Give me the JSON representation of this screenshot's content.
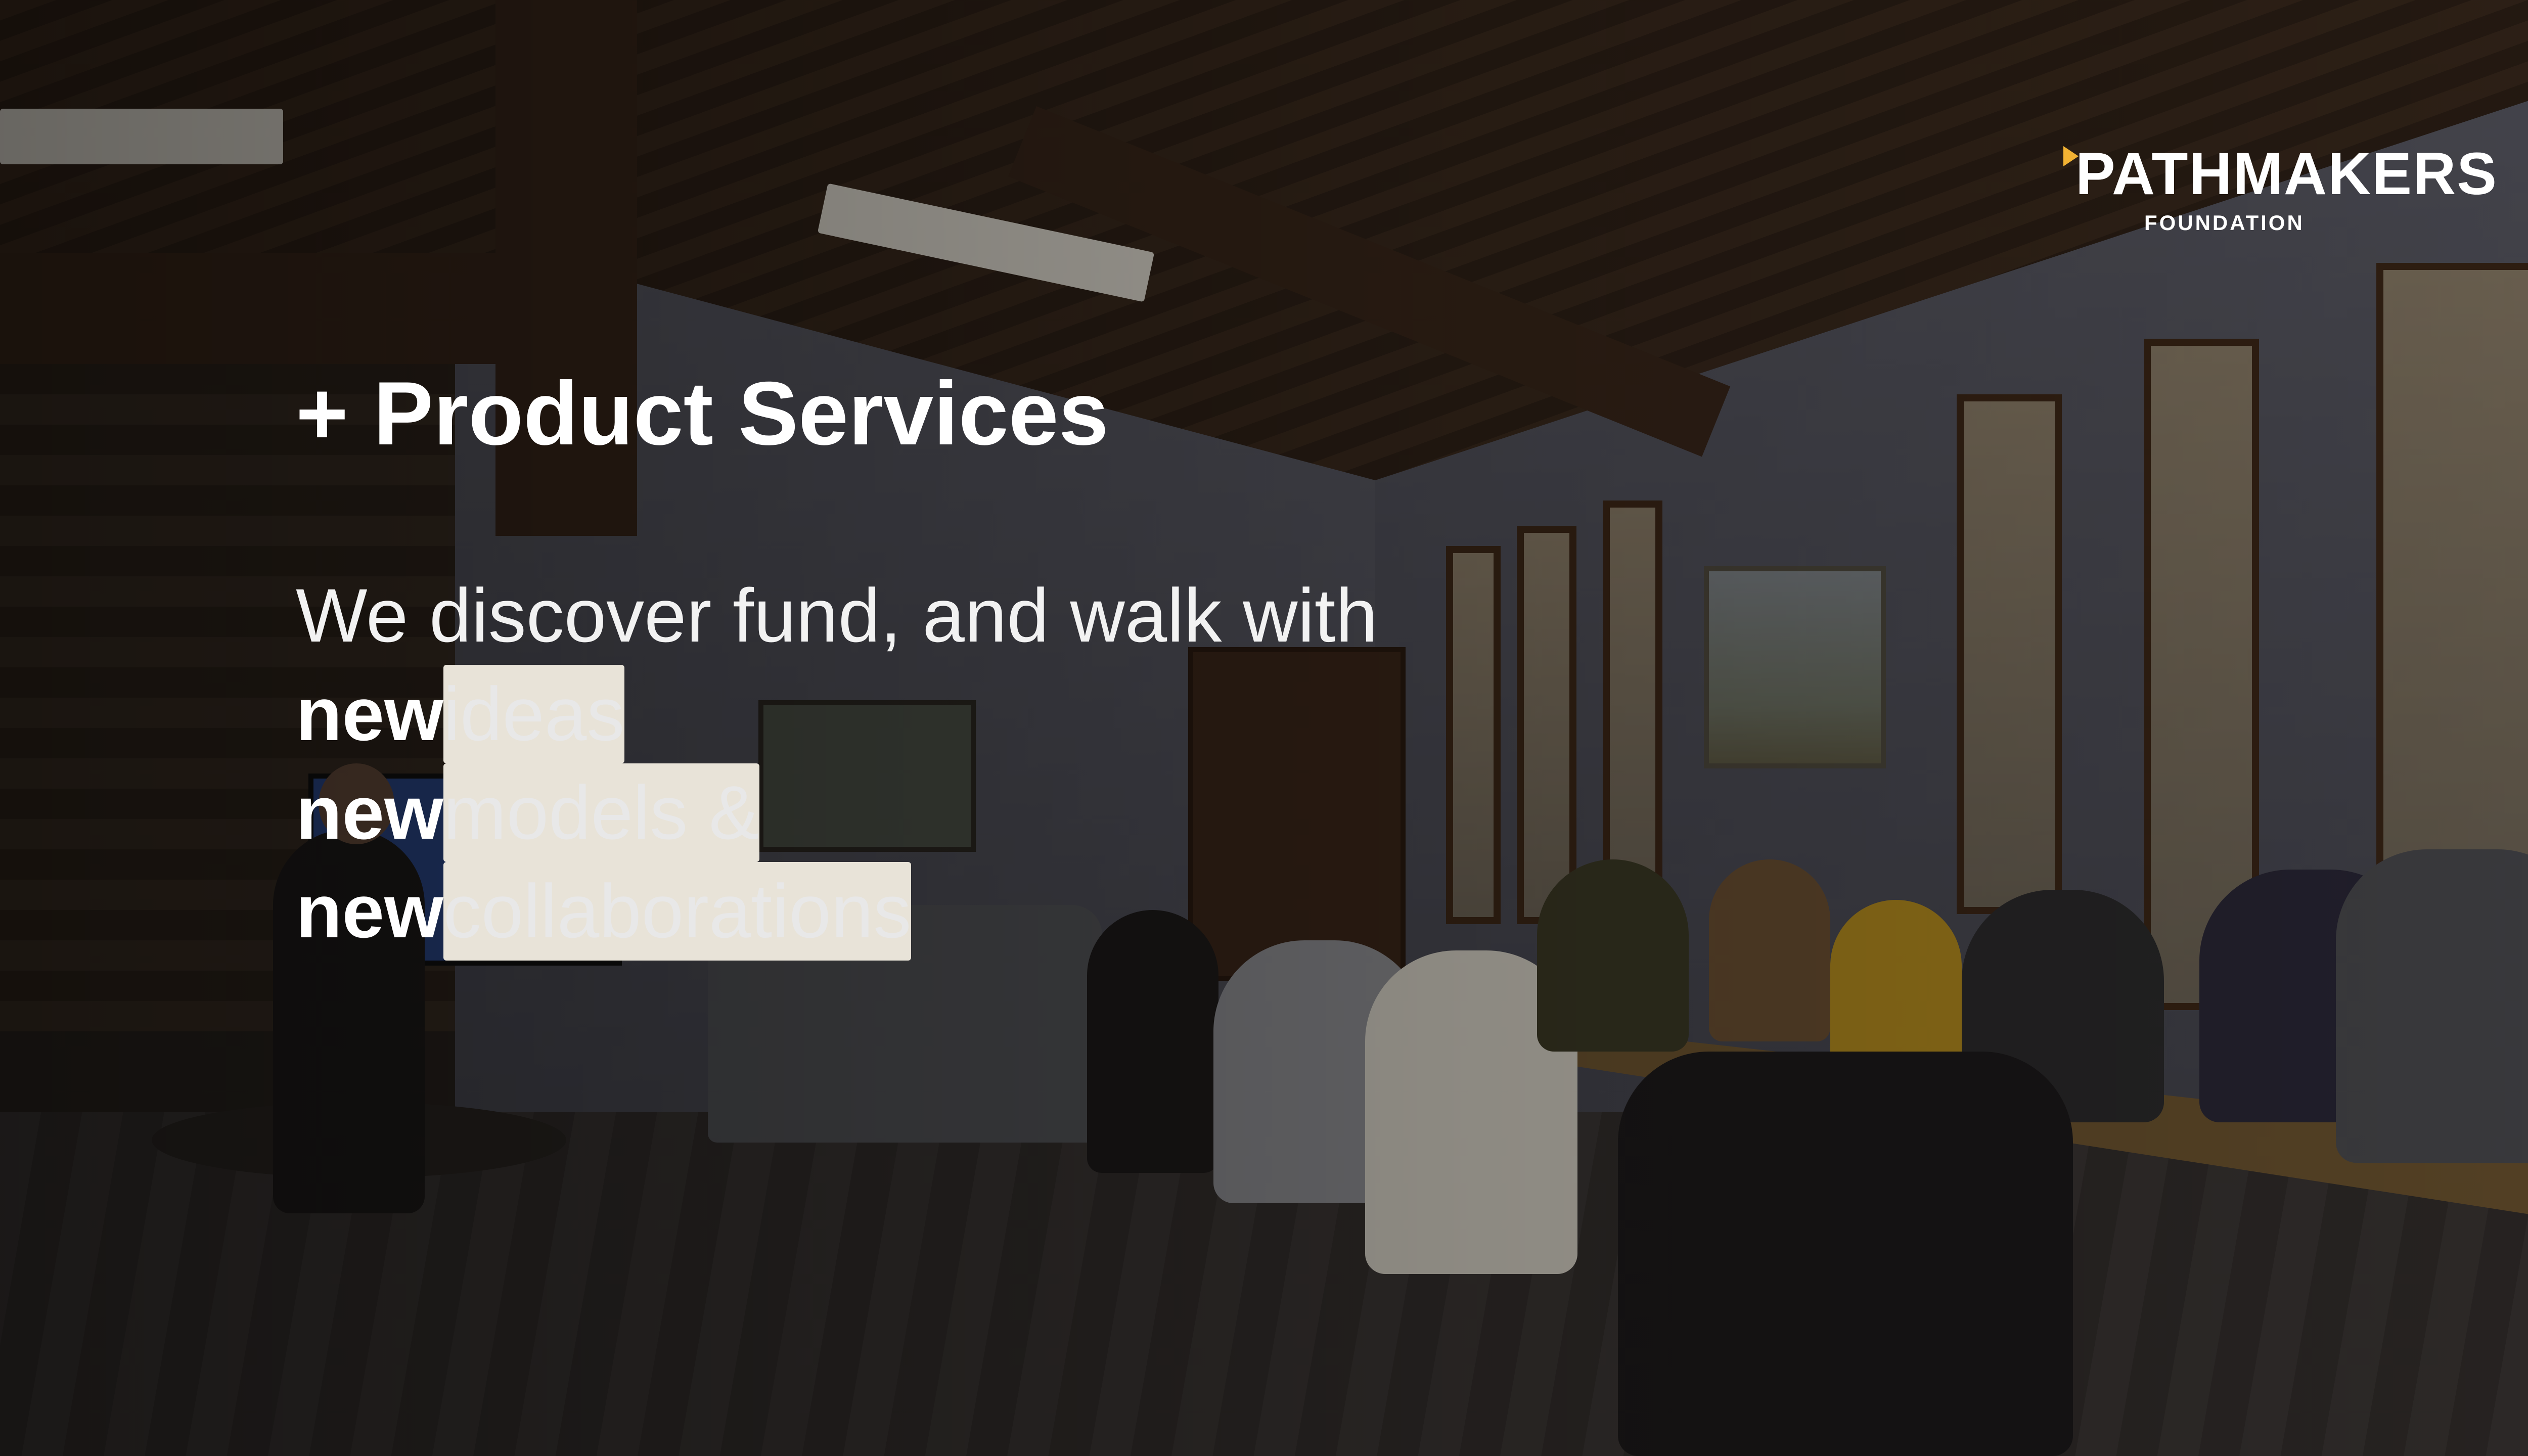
{
  "logo": {
    "name": "PATHMAKERS",
    "subtitle": "FOUNDATION",
    "accent_color": "#f2b233"
  },
  "headline": "+ Product Services",
  "body": {
    "intro": "We discover fund, and walk with",
    "lines": [
      {
        "strong": "new",
        "rest": " ideas"
      },
      {
        "strong": "new",
        "rest": " models &"
      },
      {
        "strong": "new",
        "rest": " collaborations"
      }
    ]
  }
}
